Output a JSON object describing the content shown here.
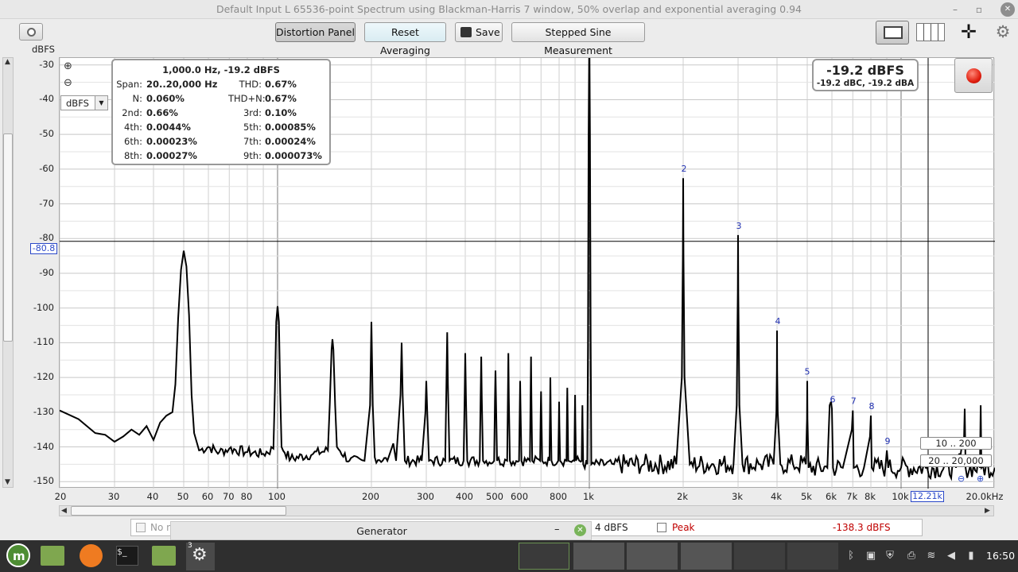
{
  "window": {
    "title": "Default Input L 65536-point Spectrum using Blackman-Harris 7 window, 50% overlap and exponential averaging 0.94"
  },
  "toolbar": {
    "distortion_panel": "Distortion Panel",
    "reset_averaging": "Reset Averaging",
    "save": "Save",
    "stepped_sine": "Stepped Sine Measurement",
    "y_unit": "dBFS"
  },
  "plot": {
    "y_ticks": [
      "-30",
      "-40",
      "-50",
      "-60",
      "-70",
      "-80",
      "-90",
      "-100",
      "-110",
      "-120",
      "-130",
      "-140",
      "-150"
    ],
    "x_ticks": [
      "20",
      "30",
      "40",
      "50",
      "60",
      "70",
      "80",
      "100",
      "200",
      "300",
      "400",
      "500",
      "600",
      "800",
      "1k",
      "2k",
      "3k",
      "4k",
      "5k",
      "6k",
      "7k",
      "8k",
      "10k",
      "20.0kHz"
    ],
    "unit_select": "dBFS",
    "cursor_y": "-80.8",
    "cursor_x": "12.21k",
    "harmonic_labels": [
      "2",
      "3",
      "4",
      "5",
      "6",
      "7",
      "8",
      "9"
    ]
  },
  "distortion": {
    "header": "1,000.0 Hz, -19.2 dBFS",
    "rows": [
      {
        "l1": "Span:",
        "v1": "20..20,000 Hz",
        "l2": "THD:",
        "v2": "0.67%"
      },
      {
        "l1": "N:",
        "v1": "0.060%",
        "l2": "THD+N:",
        "v2": "0.67%"
      },
      {
        "l1": "2nd:",
        "v1": "0.66%",
        "l2": "3rd:",
        "v2": "0.10%"
      },
      {
        "l1": "4th:",
        "v1": "0.0044%",
        "l2": "5th:",
        "v2": "0.00085%"
      },
      {
        "l1": "6th:",
        "v1": "0.00023%",
        "l2": "7th:",
        "v2": "0.00024%"
      },
      {
        "l1": "8th:",
        "v1": "0.00027%",
        "l2": "9th:",
        "v2": "0.000073%"
      }
    ]
  },
  "level": {
    "main": "-19.2 dBFS",
    "sub": "-19.2 dBC, -19.2 dBA"
  },
  "ranges": {
    "low": "10 .. 200",
    "full": "20 .. 20,000"
  },
  "legend": {
    "left_text": "No n",
    "mid_value": "4 dBFS",
    "peak_label": "Peak",
    "peak_value": "-138.3 dBFS"
  },
  "generator": {
    "title": "Generator",
    "minimize": "–"
  },
  "taskbar": {
    "clock": "16:50",
    "badge": "3"
  },
  "chart_data": {
    "type": "line",
    "x_scale": "log",
    "xlim": [
      20,
      20000
    ],
    "ylim": [
      -152,
      -28
    ],
    "ylabel": "dBFS",
    "grid": true,
    "spectrum": [
      [
        20,
        -129.5
      ],
      [
        23,
        -132
      ],
      [
        26,
        -136
      ],
      [
        28,
        -136.5
      ],
      [
        30,
        -138.5
      ],
      [
        32,
        -137
      ],
      [
        34,
        -135
      ],
      [
        36,
        -136.5
      ],
      [
        38,
        -134
      ],
      [
        40,
        -138
      ],
      [
        42,
        -133
      ],
      [
        44,
        -131
      ],
      [
        46,
        -130
      ],
      [
        47,
        -122
      ],
      [
        48,
        -103
      ],
      [
        49,
        -89
      ],
      [
        50,
        -83.5
      ],
      [
        51,
        -88
      ],
      [
        52,
        -102
      ],
      [
        53,
        -125
      ],
      [
        54,
        -136
      ],
      [
        56,
        -141
      ],
      [
        60,
        -140
      ],
      [
        65,
        -141.5
      ],
      [
        70,
        -140.5
      ],
      [
        80,
        -141.5
      ],
      [
        90,
        -142
      ],
      [
        97,
        -140.5
      ],
      [
        98,
        -124
      ],
      [
        99,
        -104
      ],
      [
        100,
        -99.5
      ],
      [
        101,
        -104
      ],
      [
        102,
        -125
      ],
      [
        103,
        -140
      ],
      [
        110,
        -143.5
      ],
      [
        130,
        -142
      ],
      [
        145,
        -141
      ],
      [
        147,
        -128
      ],
      [
        149,
        -112
      ],
      [
        150,
        -109
      ],
      [
        151,
        -112
      ],
      [
        153,
        -128
      ],
      [
        155,
        -140
      ],
      [
        170,
        -144
      ],
      [
        190,
        -144
      ],
      [
        198,
        -128
      ],
      [
        200,
        -104
      ],
      [
        202,
        -128
      ],
      [
        205,
        -143
      ],
      [
        225,
        -144
      ],
      [
        235,
        -139
      ],
      [
        240,
        -144
      ],
      [
        248,
        -125
      ],
      [
        250,
        -110
      ],
      [
        252,
        -125
      ],
      [
        256,
        -144
      ],
      [
        290,
        -144
      ],
      [
        298,
        -130
      ],
      [
        300,
        -121
      ],
      [
        302,
        -130
      ],
      [
        306,
        -144
      ],
      [
        345,
        -144
      ],
      [
        348,
        -122
      ],
      [
        350,
        -107
      ],
      [
        352,
        -122
      ],
      [
        356,
        -144
      ],
      [
        395,
        -144
      ],
      [
        398,
        -126
      ],
      [
        400,
        -113
      ],
      [
        402,
        -126
      ],
      [
        406,
        -144
      ],
      [
        445,
        -144
      ],
      [
        448,
        -126
      ],
      [
        450,
        -114
      ],
      [
        452,
        -126
      ],
      [
        456,
        -144
      ],
      [
        495,
        -144
      ],
      [
        498,
        -127
      ],
      [
        500,
        -118
      ],
      [
        502,
        -127
      ],
      [
        506,
        -144
      ],
      [
        545,
        -144
      ],
      [
        548,
        -126
      ],
      [
        550,
        -113
      ],
      [
        552,
        -126
      ],
      [
        556,
        -144
      ],
      [
        595,
        -144
      ],
      [
        598,
        -130
      ],
      [
        600,
        -121
      ],
      [
        602,
        -130
      ],
      [
        606,
        -144
      ],
      [
        645,
        -144
      ],
      [
        648,
        -126
      ],
      [
        650,
        -114
      ],
      [
        652,
        -126
      ],
      [
        656,
        -144
      ],
      [
        695,
        -144
      ],
      [
        698,
        -131
      ],
      [
        700,
        -124
      ],
      [
        702,
        -131
      ],
      [
        706,
        -144
      ],
      [
        745,
        -144
      ],
      [
        748,
        -130
      ],
      [
        750,
        -120
      ],
      [
        752,
        -130
      ],
      [
        756,
        -144
      ],
      [
        795,
        -144
      ],
      [
        798,
        -134
      ],
      [
        800,
        -127
      ],
      [
        802,
        -134
      ],
      [
        806,
        -144
      ],
      [
        845,
        -144
      ],
      [
        848,
        -130
      ],
      [
        850,
        -123
      ],
      [
        852,
        -130
      ],
      [
        856,
        -144
      ],
      [
        895,
        -144
      ],
      [
        898,
        -132
      ],
      [
        900,
        -125
      ],
      [
        902,
        -132
      ],
      [
        906,
        -144
      ],
      [
        945,
        -144
      ],
      [
        948,
        -134
      ],
      [
        950,
        -128
      ],
      [
        952,
        -134
      ],
      [
        956,
        -145
      ],
      [
        985,
        -145
      ],
      [
        990,
        -110
      ],
      [
        995,
        -50
      ],
      [
        1000,
        -19.2
      ],
      [
        1005,
        -50
      ],
      [
        1010,
        -110
      ],
      [
        1015,
        -145
      ],
      [
        1200,
        -145
      ],
      [
        1500,
        -145
      ],
      [
        1900,
        -145
      ],
      [
        1980,
        -120
      ],
      [
        1995,
        -85
      ],
      [
        2000,
        -62.6
      ],
      [
        2005,
        -85
      ],
      [
        2020,
        -120
      ],
      [
        2100,
        -145
      ],
      [
        2500,
        -145
      ],
      [
        2900,
        -145
      ],
      [
        2970,
        -128
      ],
      [
        2995,
        -95
      ],
      [
        3000,
        -79
      ],
      [
        3005,
        -95
      ],
      [
        3030,
        -128
      ],
      [
        3100,
        -145
      ],
      [
        3500,
        -145
      ],
      [
        3900,
        -145
      ],
      [
        3980,
        -130
      ],
      [
        3995,
        -118
      ],
      [
        4000,
        -106.5
      ],
      [
        4005,
        -118
      ],
      [
        4020,
        -130
      ],
      [
        4100,
        -145
      ],
      [
        4500,
        -145
      ],
      [
        4950,
        -145
      ],
      [
        4990,
        -132
      ],
      [
        5000,
        -121
      ],
      [
        5010,
        -132
      ],
      [
        5050,
        -146
      ],
      [
        5800,
        -146
      ],
      [
        5900,
        -128
      ],
      [
        5960,
        -127
      ],
      [
        6000,
        -129
      ],
      [
        6050,
        -146
      ],
      [
        6500,
        -146
      ],
      [
        6950,
        -135
      ],
      [
        7000,
        -129.5
      ],
      [
        7050,
        -146
      ],
      [
        7600,
        -146
      ],
      [
        7950,
        -137
      ],
      [
        8000,
        -131
      ],
      [
        8050,
        -146
      ],
      [
        8900,
        -146
      ],
      [
        9000,
        -141
      ],
      [
        9100,
        -146
      ],
      [
        10000,
        -146
      ],
      [
        12000,
        -146
      ],
      [
        15000,
        -146
      ],
      [
        15900,
        -140
      ],
      [
        16000,
        -129
      ],
      [
        16100,
        -146
      ],
      [
        17900,
        -146
      ],
      [
        18000,
        -128
      ],
      [
        18100,
        -146
      ],
      [
        20000,
        -146
      ]
    ]
  }
}
